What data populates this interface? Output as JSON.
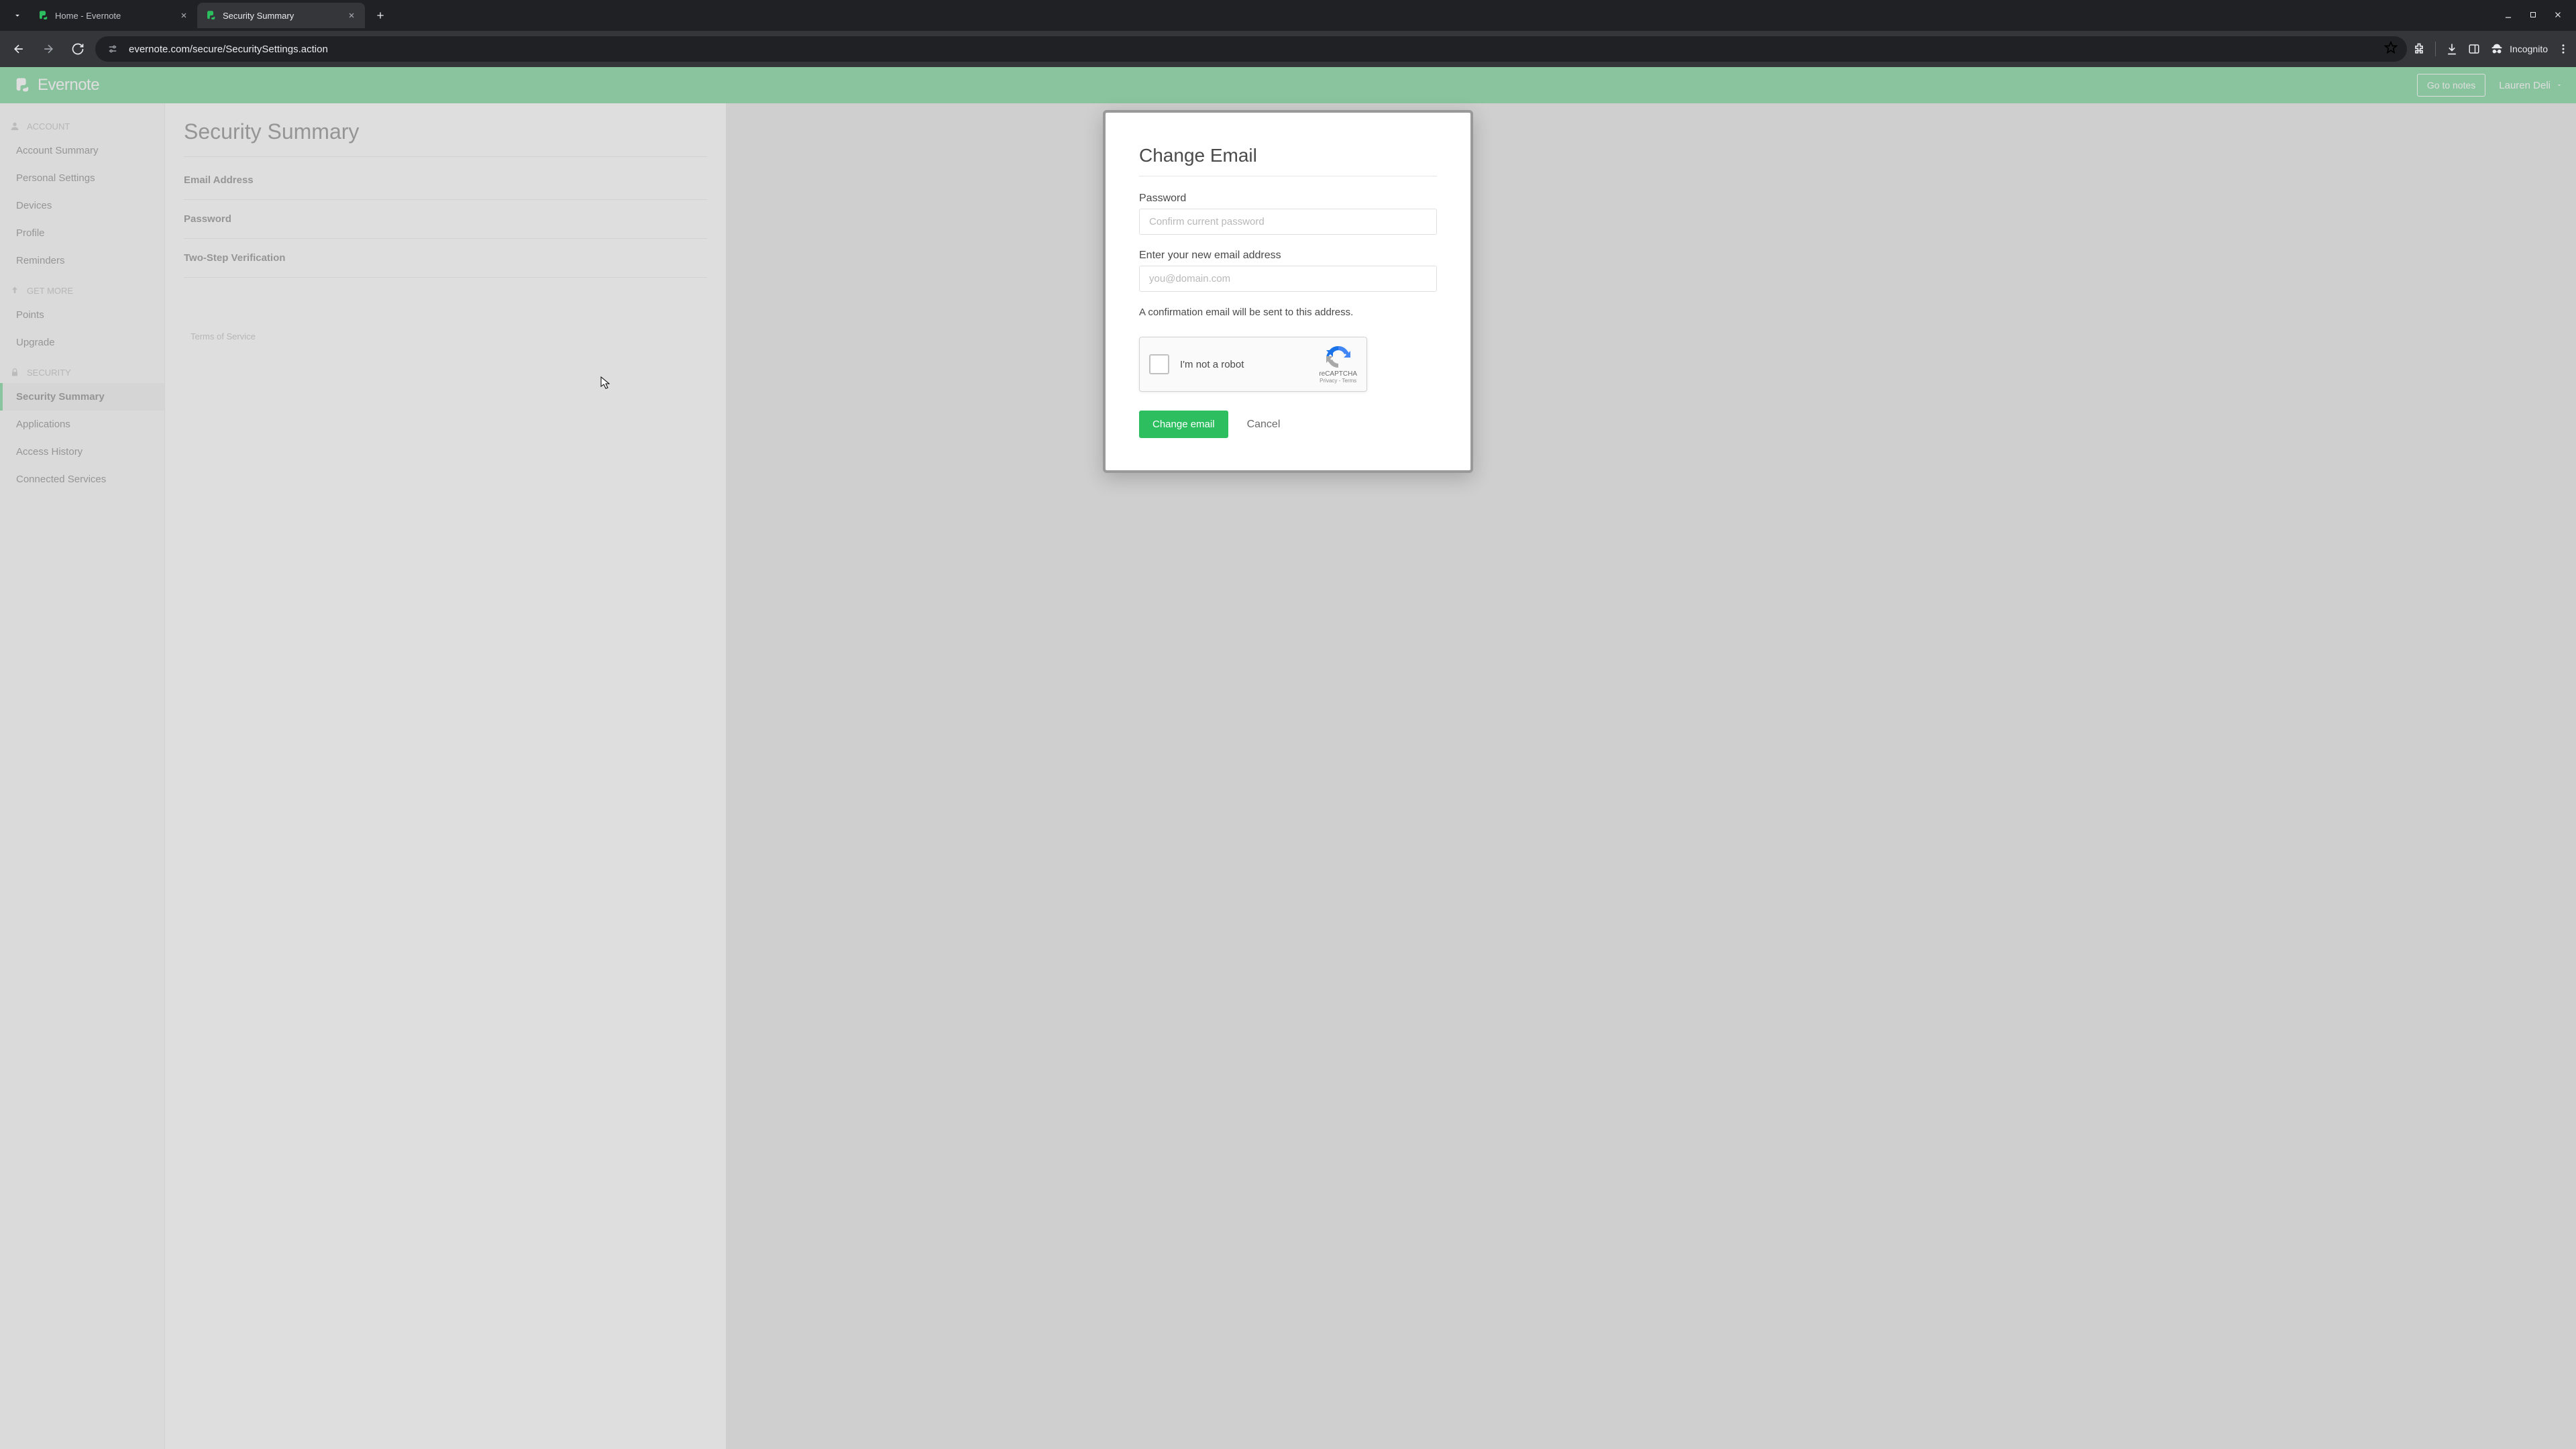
{
  "browser": {
    "tabs": [
      {
        "title": "Home - Evernote",
        "favicon": "evernote"
      },
      {
        "title": "Security Summary",
        "favicon": "evernote"
      }
    ],
    "url": "evernote.com/secure/SecuritySettings.action",
    "incognito_label": "Incognito"
  },
  "header": {
    "brand": "Evernote",
    "go_to_notes": "Go to notes",
    "user_name": "Lauren Deli"
  },
  "sidebar": {
    "sections": [
      {
        "label": "ACCOUNT",
        "items": [
          "Account Summary",
          "Personal Settings",
          "Devices",
          "Profile",
          "Reminders"
        ]
      },
      {
        "label": "GET MORE",
        "items": [
          "Points",
          "Upgrade"
        ]
      },
      {
        "label": "SECURITY",
        "items": [
          "Security Summary",
          "Applications",
          "Access History",
          "Connected Services"
        ]
      }
    ],
    "active_item": "Security Summary"
  },
  "main": {
    "page_title": "Security Summary",
    "rows": [
      "Email Address",
      "Password",
      "Two-Step Verification"
    ],
    "footer": [
      "Terms of Service"
    ]
  },
  "modal": {
    "title": "Change Email",
    "password_label": "Password",
    "password_placeholder": "Confirm current password",
    "email_label": "Enter your new email address",
    "email_placeholder": "you@domain.com",
    "help_text": "A confirmation email will be sent to this address.",
    "recaptcha_label": "I'm not a robot",
    "recaptcha_name": "reCAPTCHA",
    "recaptcha_links": "Privacy - Terms",
    "submit_label": "Change email",
    "cancel_label": "Cancel"
  }
}
